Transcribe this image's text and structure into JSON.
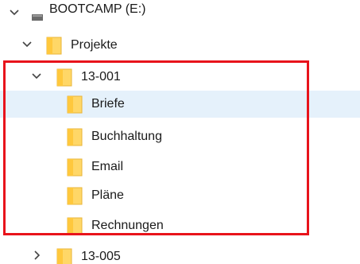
{
  "tree": {
    "items": [
      {
        "label": "BOOTCAMP (E:)",
        "icon": "drive-icon",
        "expanded": true
      },
      {
        "label": "Projekte",
        "icon": "folder-icon",
        "expanded": true
      },
      {
        "label": "13-001",
        "icon": "folder-icon",
        "expanded": true
      },
      {
        "label": "Briefe",
        "icon": "folder-icon",
        "selected": true
      },
      {
        "label": "Buchhaltung",
        "icon": "folder-icon"
      },
      {
        "label": "Email",
        "icon": "folder-icon"
      },
      {
        "label": "Pläne",
        "icon": "folder-icon"
      },
      {
        "label": "Rechnungen",
        "icon": "folder-icon"
      },
      {
        "label": "13-005",
        "icon": "folder-icon",
        "expanded": false
      }
    ]
  },
  "colors": {
    "selection": "#e5f1fb",
    "highlight_border": "#e8131b",
    "folder_body": "#ffd767",
    "folder_tab": "#ffc83d"
  }
}
